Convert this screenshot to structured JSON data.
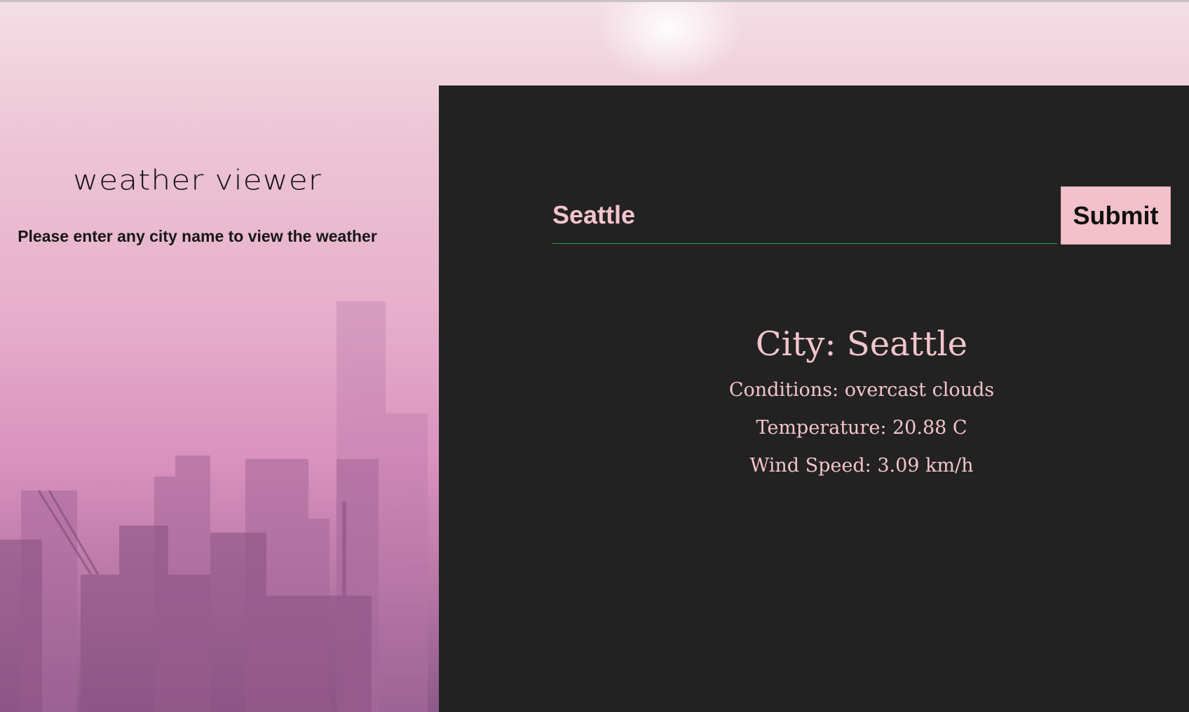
{
  "header": {
    "title": "weather viewer",
    "subtitle": "Please enter any city name to view the weather"
  },
  "search": {
    "value": "Seattle",
    "submit_label": "Submit"
  },
  "result": {
    "city": "City: Seattle",
    "conditions": "Conditions: overcast clouds",
    "temperature": "Temperature: 20.88 C",
    "wind_speed": "Wind Speed: 3.09 km/h"
  },
  "colors": {
    "panel_bg": "#222222",
    "accent_pink": "#f3c4cc",
    "input_underline": "#2e9a4f"
  }
}
